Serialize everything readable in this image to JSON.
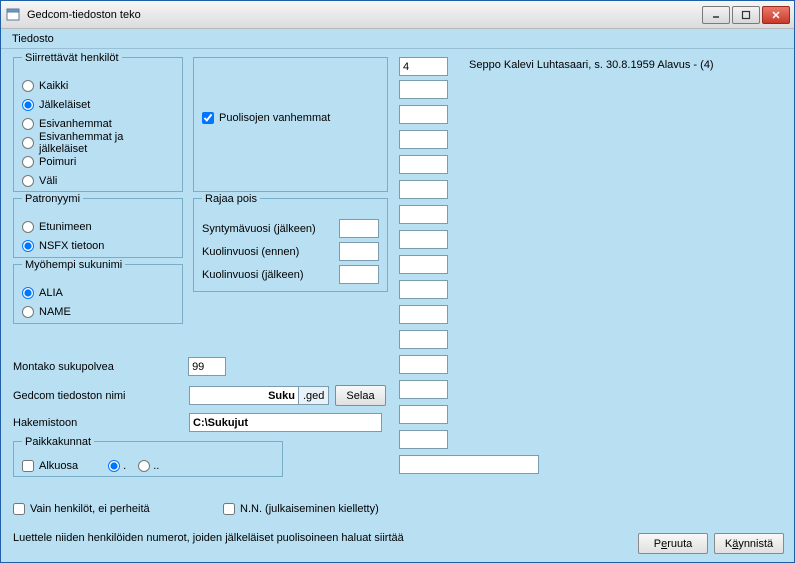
{
  "window": {
    "title": "Gedcom-tiedoston teko"
  },
  "menu": {
    "file": "Tiedosto"
  },
  "groups": {
    "transfer": {
      "legend": "Siirrettävät henkilöt",
      "opt_all": "Kaikki",
      "opt_desc": "Jälkeläiset",
      "opt_anc": "Esivanhemmat",
      "opt_anc_desc": "Esivanhemmat ja jälkeläiset",
      "opt_poimuri": "Poimuri",
      "opt_vali": "Väli"
    },
    "patronym": {
      "legend": "Patronyymi",
      "opt_etu": "Etunimeen",
      "opt_nsfx": "NSFX tietoon"
    },
    "surname": {
      "legend": "Myöhempi sukunimi",
      "opt_alia": "ALIA",
      "opt_name": "NAME"
    },
    "spouse_parents": "Puolisojen vanhemmat",
    "exclude": {
      "legend": "Rajaa pois",
      "birth_after": "Syntymävuosi (jälkeen)",
      "death_before": "Kuolinvuosi (ennen)",
      "death_after": "Kuolinvuosi (jälkeen)"
    },
    "places": {
      "legend": "Paikkakunnat",
      "alkuosa": "Alkuosa",
      "r1": ".",
      "r2": ".."
    }
  },
  "labels": {
    "generations": "Montako sukupolvea",
    "gedcom_name": "Gedcom tiedoston nimi",
    "directory": "Hakemistoon",
    "browse": "Selaa",
    "persons_only": "Vain henkilöt, ei perheitä",
    "nn_forbidden": "N.N. (julkaiseminen kielletty)"
  },
  "values": {
    "generations": "99",
    "gedcom_name": "Suku",
    "gedcom_ext": ".ged",
    "directory": "C:\\Sukujut",
    "first_id": "4"
  },
  "info_text": "Seppo Kalevi Luhtasaari,  s. 30.8.1959 Alavus - (4)",
  "hint": "Luettele niiden henkilöiden numerot, joiden jälkeläiset puolisoineen haluat siirtää",
  "buttons": {
    "cancel_pre": "P",
    "cancel_u": "e",
    "cancel_post": "ruuta",
    "run_pre": "K",
    "run_u": "ä",
    "run_post": "ynnistä"
  }
}
